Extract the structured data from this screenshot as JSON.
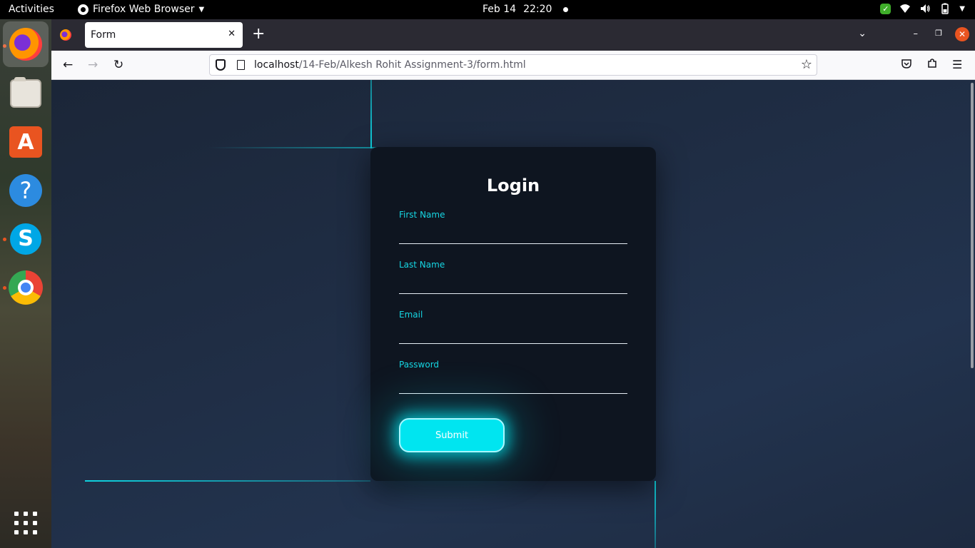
{
  "topbar": {
    "activities": "Activities",
    "app_name": "Firefox Web Browser",
    "date": "Feb 14",
    "time": "22:20"
  },
  "dock": {
    "items": [
      "firefox",
      "files",
      "software-store",
      "help",
      "skype",
      "chrome"
    ]
  },
  "browser": {
    "tab_title": "Form",
    "url_host": "localhost",
    "url_path": "/14-Feb/Alkesh Rohit Assignment-3/form.html"
  },
  "page": {
    "heading": "Login",
    "fields": [
      {
        "label": "First Name",
        "value": ""
      },
      {
        "label": "Last Name",
        "value": ""
      },
      {
        "label": "Email",
        "value": ""
      },
      {
        "label": "Password",
        "value": ""
      }
    ],
    "submit_label": "Submit"
  },
  "colors": {
    "accent": "#00e5f0",
    "label": "#16d6e3",
    "card": "#0e1520",
    "background": "#1f2d44",
    "close": "#e95420"
  }
}
